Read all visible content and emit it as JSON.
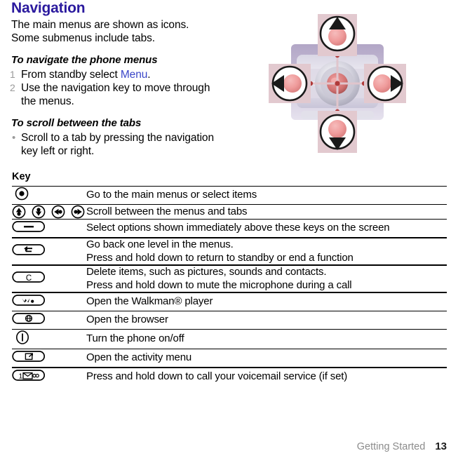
{
  "page": {
    "heading": "Navigation",
    "intro": [
      "The main menus are shown as icons.",
      "Some submenus include tabs."
    ],
    "sections": [
      {
        "title": "To navigate the phone menus",
        "type": "numbered",
        "items": [
          {
            "marker": "1",
            "text_before": "From standby select ",
            "link": "Menu",
            "text_after": "."
          },
          {
            "marker": "2",
            "text_before": "Use the navigation key to move through the menus.",
            "link": "",
            "text_after": ""
          }
        ]
      },
      {
        "title": "To scroll between the tabs",
        "type": "bulleted",
        "items": [
          {
            "marker": "•",
            "text_before": "Scroll to a tab by pressing the navigation key left or right.",
            "link": "",
            "text_after": ""
          }
        ]
      }
    ]
  },
  "illustration": {
    "name": "navigation-key-diagram",
    "alt": "Phone navigation key with four directional callouts and centre select",
    "colors": {
      "callout_bg": "#e2c9cf",
      "button_fill": "#ef9b9b",
      "ring": "#ffffff",
      "outline": "#1a1a1a",
      "phone_body": "#c8c5d6",
      "phone_highlight": "#eceaf2",
      "purple_shadow": "#9b8fb8"
    }
  },
  "key_table": {
    "title": "Key",
    "rows": [
      {
        "icons": [
          "key-center-select-icon"
        ],
        "desc": [
          "Go to the main menus or select items"
        ]
      },
      {
        "icons": [
          "key-nav-up-icon",
          "key-nav-down-icon",
          "key-nav-left-icon",
          "key-nav-right-icon"
        ],
        "desc": [
          "Scroll between the menus and tabs"
        ]
      },
      {
        "icons": [
          "key-selection-soft-icon"
        ],
        "desc": [
          "Select options shown immediately above these keys on the screen"
        ]
      },
      {
        "icons": [
          "key-back-icon"
        ],
        "desc": [
          "Go back one level in the menus.",
          "Press and hold down to return to standby or end a function"
        ]
      },
      {
        "icons": [
          "key-clear-c-icon"
        ],
        "desc": [
          "Delete items, such as pictures, sounds and contacts.",
          "Press and hold down to mute the microphone during a call"
        ]
      },
      {
        "icons": [
          "key-walkman-icon"
        ],
        "desc": [
          "Open the Walkman® player"
        ]
      },
      {
        "icons": [
          "key-browser-globe-icon"
        ],
        "desc": [
          "Open the browser"
        ]
      },
      {
        "icons": [
          "key-power-onoff-icon"
        ],
        "desc": [
          "Turn the phone on/off"
        ]
      },
      {
        "icons": [
          "key-activity-menu-icon"
        ],
        "desc": [
          "Open the activity menu"
        ]
      },
      {
        "icons": [
          "key-voicemail-one-icon"
        ],
        "desc": [
          "Press and hold down to call your voicemail service (if set)"
        ]
      }
    ]
  },
  "footer": {
    "section": "Getting Started",
    "page_number": "13"
  }
}
